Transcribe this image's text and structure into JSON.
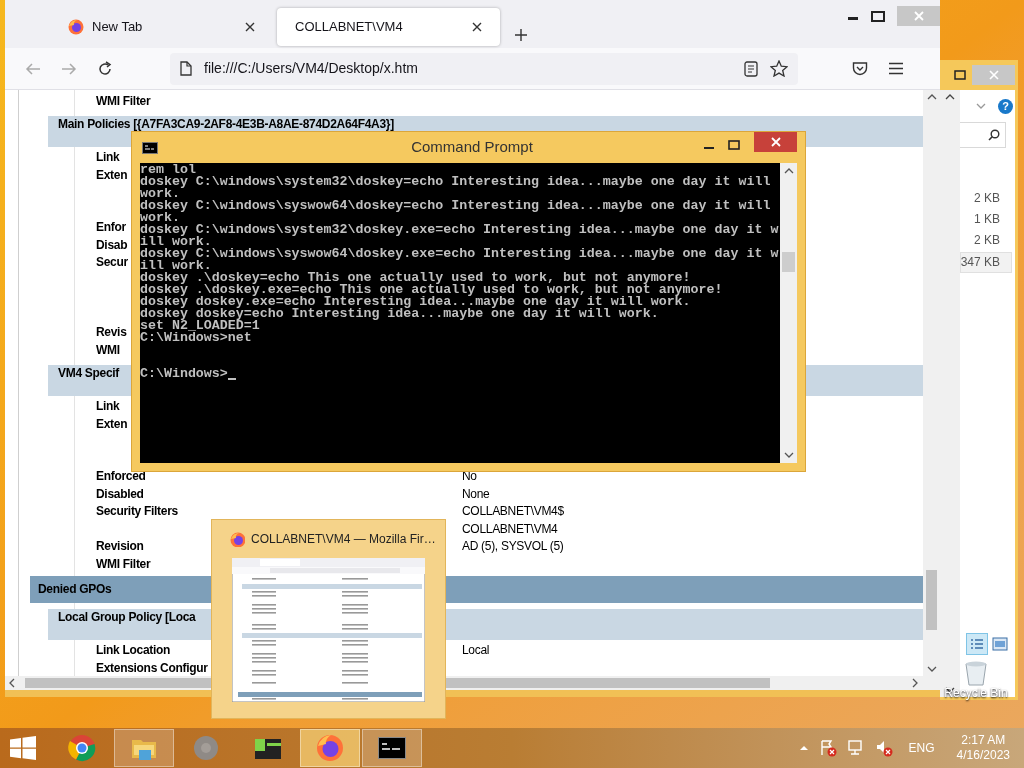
{
  "explorer": {
    "help_label": "?",
    "sizes": [
      {
        "text": "2 KB",
        "selected": false
      },
      {
        "text": "1 KB",
        "selected": false
      },
      {
        "text": "2 KB",
        "selected": false
      },
      {
        "text": "347 KB",
        "selected": true
      }
    ]
  },
  "desktop": {
    "recycle_bin": "Recycle Bin"
  },
  "browser": {
    "tabs": [
      {
        "label": "New Tab",
        "selected": false
      },
      {
        "label": "COLLABNET\\VM4",
        "selected": true
      }
    ],
    "url": "file:///C:/Users/VM4/Desktop/x.htm",
    "rows": [
      {
        "kind": "field",
        "label": "WMI Filter"
      },
      {
        "kind": "section",
        "title": "Main Policies [{A7FA3CA9-2AF8-4E3B-A8AE-874D2A64F4A3}]"
      },
      {
        "kind": "field",
        "label": "Link"
      },
      {
        "kind": "field",
        "label": "Exten"
      },
      {
        "kind": "spacer"
      },
      {
        "kind": "spacer"
      },
      {
        "kind": "field",
        "label": "Enfor"
      },
      {
        "kind": "field",
        "label": "Disab"
      },
      {
        "kind": "field",
        "label": "Secur"
      },
      {
        "kind": "spacer"
      },
      {
        "kind": "spacer"
      },
      {
        "kind": "spacer"
      },
      {
        "kind": "field",
        "label": "Revis"
      },
      {
        "kind": "field",
        "label": "WMI"
      },
      {
        "kind": "section",
        "title": "VM4 Specif"
      },
      {
        "kind": "field",
        "label": "Link"
      },
      {
        "kind": "field",
        "label": "Exten"
      },
      {
        "kind": "spacer"
      },
      {
        "kind": "spacer"
      },
      {
        "kind": "field",
        "label": "Enforced",
        "value": "No"
      },
      {
        "kind": "field",
        "label": "Disabled",
        "value": "None"
      },
      {
        "kind": "field",
        "label": "Security Filters",
        "value": "COLLABNET\\VM4$"
      },
      {
        "kind": "field",
        "value": "COLLABNET\\VM4"
      },
      {
        "kind": "field",
        "label": "Revision",
        "value": "AD (5), SYSVOL (5)"
      },
      {
        "kind": "field",
        "label": "WMI Filter"
      },
      {
        "kind": "group",
        "title": "Denied GPOs"
      },
      {
        "kind": "section",
        "title": "Local Group Policy [Loca"
      },
      {
        "kind": "field",
        "label": "Link Location",
        "value": "Local"
      },
      {
        "kind": "field",
        "label": "Extensions Configur"
      }
    ]
  },
  "cmd": {
    "title": "Command Prompt",
    "lines": [
      "rem lol",
      "doskey C:\\windows\\system32\\doskey=echo Interesting idea...maybe one day it will",
      "work.",
      "doskey C:\\windows\\syswow64\\doskey=echo Interesting idea...maybe one day it will",
      "work.",
      "doskey C:\\windows\\system32\\doskey.exe=echo Interesting idea...maybe one day it w",
      "ill work.",
      "doskey C:\\windows\\syswow64\\doskey.exe=echo Interesting idea...maybe one day it w",
      "ill work.",
      "doskey .\\doskey=echo This one actually used to work, but not anymore!",
      "doskey .\\doskey.exe=echo This one actually used to work, but not anymore!",
      "doskey doskey.exe=echo Interesting idea...maybe one day it will work.",
      "doskey doskey=echo Interesting idea...maybe one day it will work.",
      "set N2_LOADED=1",
      "C:\\Windows>net"
    ],
    "prompt": "C:\\Windows>"
  },
  "preview": {
    "title": "COLLABNET\\VM4 — Mozilla Fir…"
  },
  "taskbar": {
    "apps": [
      {
        "kind": "chrome",
        "running": false,
        "selected": false
      },
      {
        "kind": "files",
        "running": true,
        "selected": false
      },
      {
        "kind": "disc",
        "running": false,
        "selected": false
      },
      {
        "kind": "terminal-green",
        "running": false,
        "selected": false
      },
      {
        "kind": "firefox",
        "running": true,
        "selected": true
      },
      {
        "kind": "cmd",
        "running": true,
        "selected": false
      }
    ],
    "language": "ENG",
    "time": "2:17 AM",
    "date": "4/16/2023"
  }
}
